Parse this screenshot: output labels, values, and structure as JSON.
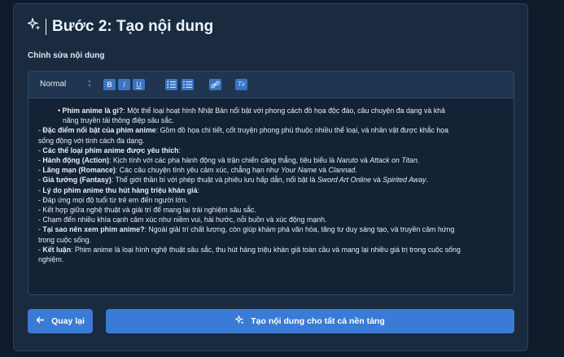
{
  "step_title": "Bước 2: Tạo nội dung",
  "editor_label": "Chỉnh sửa nội dung",
  "toolbar": {
    "format_select": "Normal",
    "bold": "B",
    "italic": "I",
    "underline": "U",
    "ordered_list": "1.",
    "bullet_list": "•",
    "link": "link",
    "clean": "Tx"
  },
  "content": {
    "l1_b": "Phim anime là gì?",
    "l1_t": ": Một thể loại hoạt hình Nhật Bản nổi bật với phong cách đồ họa độc đáo, câu chuyện đa dạng và khả",
    "l1_t2": "năng truyền tải thông điệp sâu sắc.",
    "l2_b": "Đặc điểm nổi bật của phim anime",
    "l2_t": ": Gồm đồ họa chi tiết, cốt truyện phong phú thuộc nhiều thể loại, và nhân vật được khắc họa",
    "l2_t2": "sống động với tính cách đa dạng.",
    "l3_b": "Các thể loại phim anime được yêu thích",
    "l4_b": "Hành động (Action)",
    "l4_t": ": Kịch tính với các pha hành động và trận chiến căng thẳng, tiêu biểu là",
    "l4_i1": "Naruto",
    "l4_t2": "và",
    "l4_i2": "Attack on Titan",
    "l5_b": "Lãng mạn (Romance)",
    "l5_t": ": Các câu chuyện tình yêu cảm xúc, chẳng hạn như",
    "l5_i1": "Your Name",
    "l5_t2": "và",
    "l5_i2": "Clannad",
    "l6_b": "Giả tưởng (Fantasy)",
    "l6_t": ": Thế giới thần bí với phép thuật và phiêu lưu hấp dẫn, nổi bật là",
    "l6_i1": "Sword Art Online",
    "l6_t2": "và",
    "l6_i2": "Spirited Away",
    "l7_b": "Lý do phim anime thu hút hàng triệu khán giả",
    "l8": "Đáp ứng mọi độ tuổi từ trẻ em đến người lớn.",
    "l9": "Kết hợp giữa nghệ thuật và giải trí để mang lại trải nghiệm sâu sắc.",
    "l10": "Chạm đến nhiều khía cạnh cảm xúc như niềm vui, hài hước, nỗi buồn và xúc động mạnh.",
    "l11_b": "Tại sao nên xem phim anime?",
    "l11_t": ": Ngoài giải trí chất lượng, còn giúp khám phá văn hóa, tăng tư duy sáng tạo, và truyền cảm hứng",
    "l11_t2": "trong cuộc sống.",
    "l12_b": "Kết luận",
    "l12_t": ": Phim anime là loại hình nghệ thuật sâu sắc, thu hút hàng triệu khán giả toàn cầu và mang lại nhiều giá trị trong cuộc sống",
    "l12_t2": "nghiệm."
  },
  "buttons": {
    "back": "Quay lại",
    "generate": "Tạo nội dung cho tất cả nền tảng"
  },
  "colors": {
    "accent": "#3a7bd5",
    "card": "#1a2b40",
    "background": "#0f1b2b"
  }
}
